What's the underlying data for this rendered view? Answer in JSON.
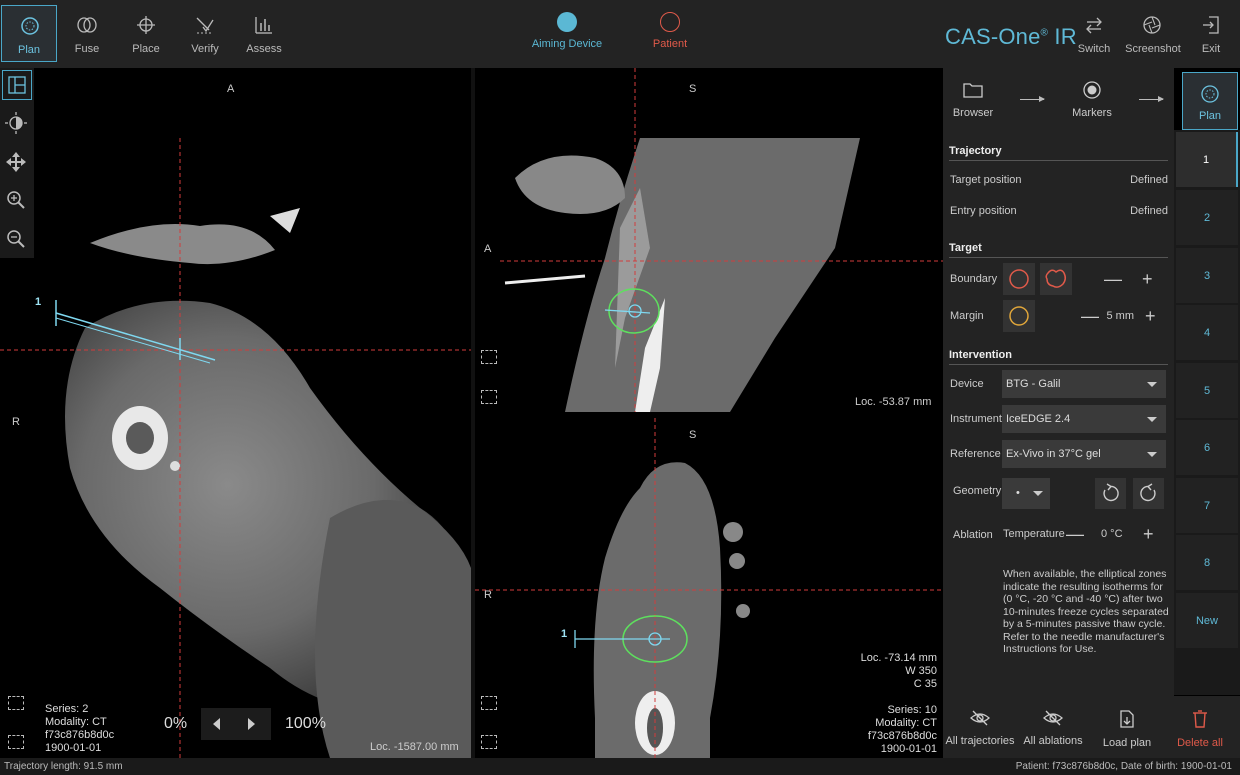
{
  "toolbar": {
    "tools": [
      {
        "label": "Plan",
        "active": true
      },
      {
        "label": "Fuse"
      },
      {
        "label": "Place"
      },
      {
        "label": "Verify"
      },
      {
        "label": "Assess"
      }
    ],
    "aiming_device": {
      "label": "Aiming Device",
      "color": "#5bb8d4"
    },
    "patient": {
      "label": "Patient",
      "color": "#e05a4a"
    },
    "brand": "CAS-One",
    "brand_sup": "®",
    "brand_suffix": " IR",
    "switch_label": "Switch",
    "screenshot_label": "Screenshot",
    "exit_label": "Exit"
  },
  "viewports": {
    "axial": {
      "top_label": "A",
      "left_label": "R",
      "trajectory_label": "1",
      "series": "Series: 2",
      "modality": "Modality: CT",
      "id": "f73c876b8d0c",
      "date": "1900-01-01",
      "zoom_min": "0%",
      "zoom_max": "100%",
      "loc": "Loc. -1587.00 mm"
    },
    "sagittal": {
      "top_label": "S",
      "left_label": "A",
      "loc": "Loc. -53.87 mm"
    },
    "coronal": {
      "top_label": "S",
      "left_label": "R",
      "trajectory_label": "1",
      "loc": "Loc. -73.14 mm",
      "w": "W 350",
      "c": "C 35",
      "series": "Series: 10",
      "modality": "Modality: CT",
      "id": "f73c876b8d0c",
      "date": "1900-01-01"
    }
  },
  "workflow": {
    "browser": "Browser",
    "markers": "Markers",
    "plan": "Plan"
  },
  "panel": {
    "trajectory_title": "Trajectory",
    "target_position_label": "Target position",
    "target_position_value": "Defined",
    "entry_position_label": "Entry position",
    "entry_position_value": "Defined",
    "target_title": "Target",
    "boundary_label": "Boundary",
    "margin_label": "Margin",
    "margin_value": "5 mm",
    "intervention_title": "Intervention",
    "device_label": "Device",
    "device_value": "BTG - Galil",
    "instrument_label": "Instrument",
    "instrument_value": "IceEDGE 2.4",
    "reference_label": "Reference",
    "reference_value": "Ex-Vivo in 37°C gel",
    "geometry_label": "Geometry",
    "geometry_value": "•",
    "ablation_label": "Ablation",
    "temperature_label": "Temperature",
    "temperature_value": "0 °C",
    "note": "When available, the elliptical zones indicate the resulting isotherms for (0 °C, -20 °C and -40 °C) after two 10-minutes freeze cycles separated by a 5-minutes passive thaw cycle. Refer to the needle manufacturer's Instructions for Use."
  },
  "trajectories": [
    "1",
    "2",
    "3",
    "4",
    "5",
    "6",
    "7",
    "8",
    "New"
  ],
  "actions": {
    "all_trajectories": "All trajectories",
    "all_ablations": "All ablations",
    "load_plan": "Load plan",
    "delete_all": "Delete all"
  },
  "statusbar": {
    "trajectory_length": "Trajectory length: 91.5 mm",
    "patient_info": "Patient: f73c876b8d0c,  Date of birth: 1900-01-01"
  }
}
